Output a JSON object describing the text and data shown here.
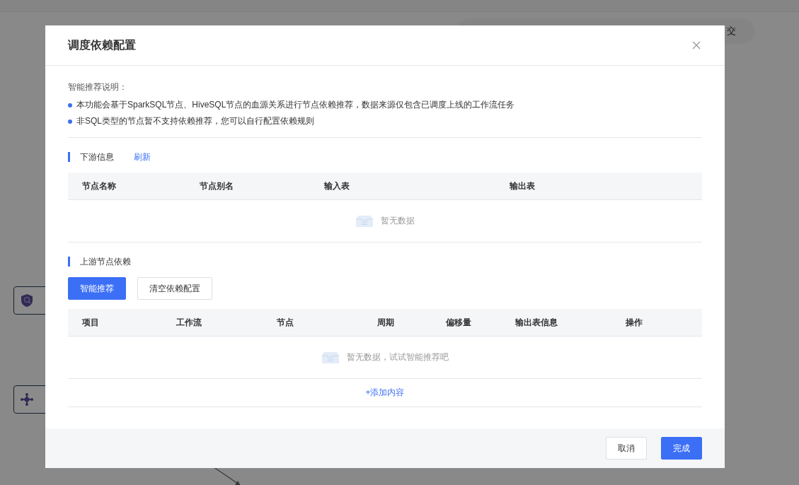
{
  "background": {
    "submit_pill": {
      "text": "交"
    },
    "nodes": [
      {
        "kind": "shield"
      },
      {
        "kind": "network"
      }
    ]
  },
  "dialog": {
    "title": "调度依赖配置",
    "notes": {
      "heading": "智能推荐说明：",
      "items": [
        "本功能会基于SparkSQL节点、HiveSQL节点的血源关系进行节点依赖推荐，数据来源仅包含已调度上线的工作流任务",
        "非SQL类型的节点暂不支持依赖推荐，您可以自行配置依赖规则"
      ]
    },
    "downstream": {
      "title": "下游信息",
      "refresh_link": "刷新",
      "table": {
        "columns": [
          "节点名称",
          "节点别名",
          "输入表",
          "输出表"
        ],
        "empty_text": "暂无数据"
      }
    },
    "upstream": {
      "title": "上游节点依赖",
      "buttons": [
        {
          "label": "智能推荐",
          "kind": "primary"
        },
        {
          "label": "清空依赖配置",
          "kind": "default"
        }
      ],
      "table": {
        "columns": [
          "项目",
          "工作流",
          "节点",
          "周期",
          "偏移量",
          "输出表信息",
          "操作"
        ],
        "empty_text": "暂无数据，试试智能推荐吧",
        "add_link": "+添加内容"
      }
    },
    "footer": {
      "buttons": [
        {
          "label": "取消",
          "kind": "default"
        },
        {
          "label": "完成",
          "kind": "primary"
        }
      ]
    }
  }
}
